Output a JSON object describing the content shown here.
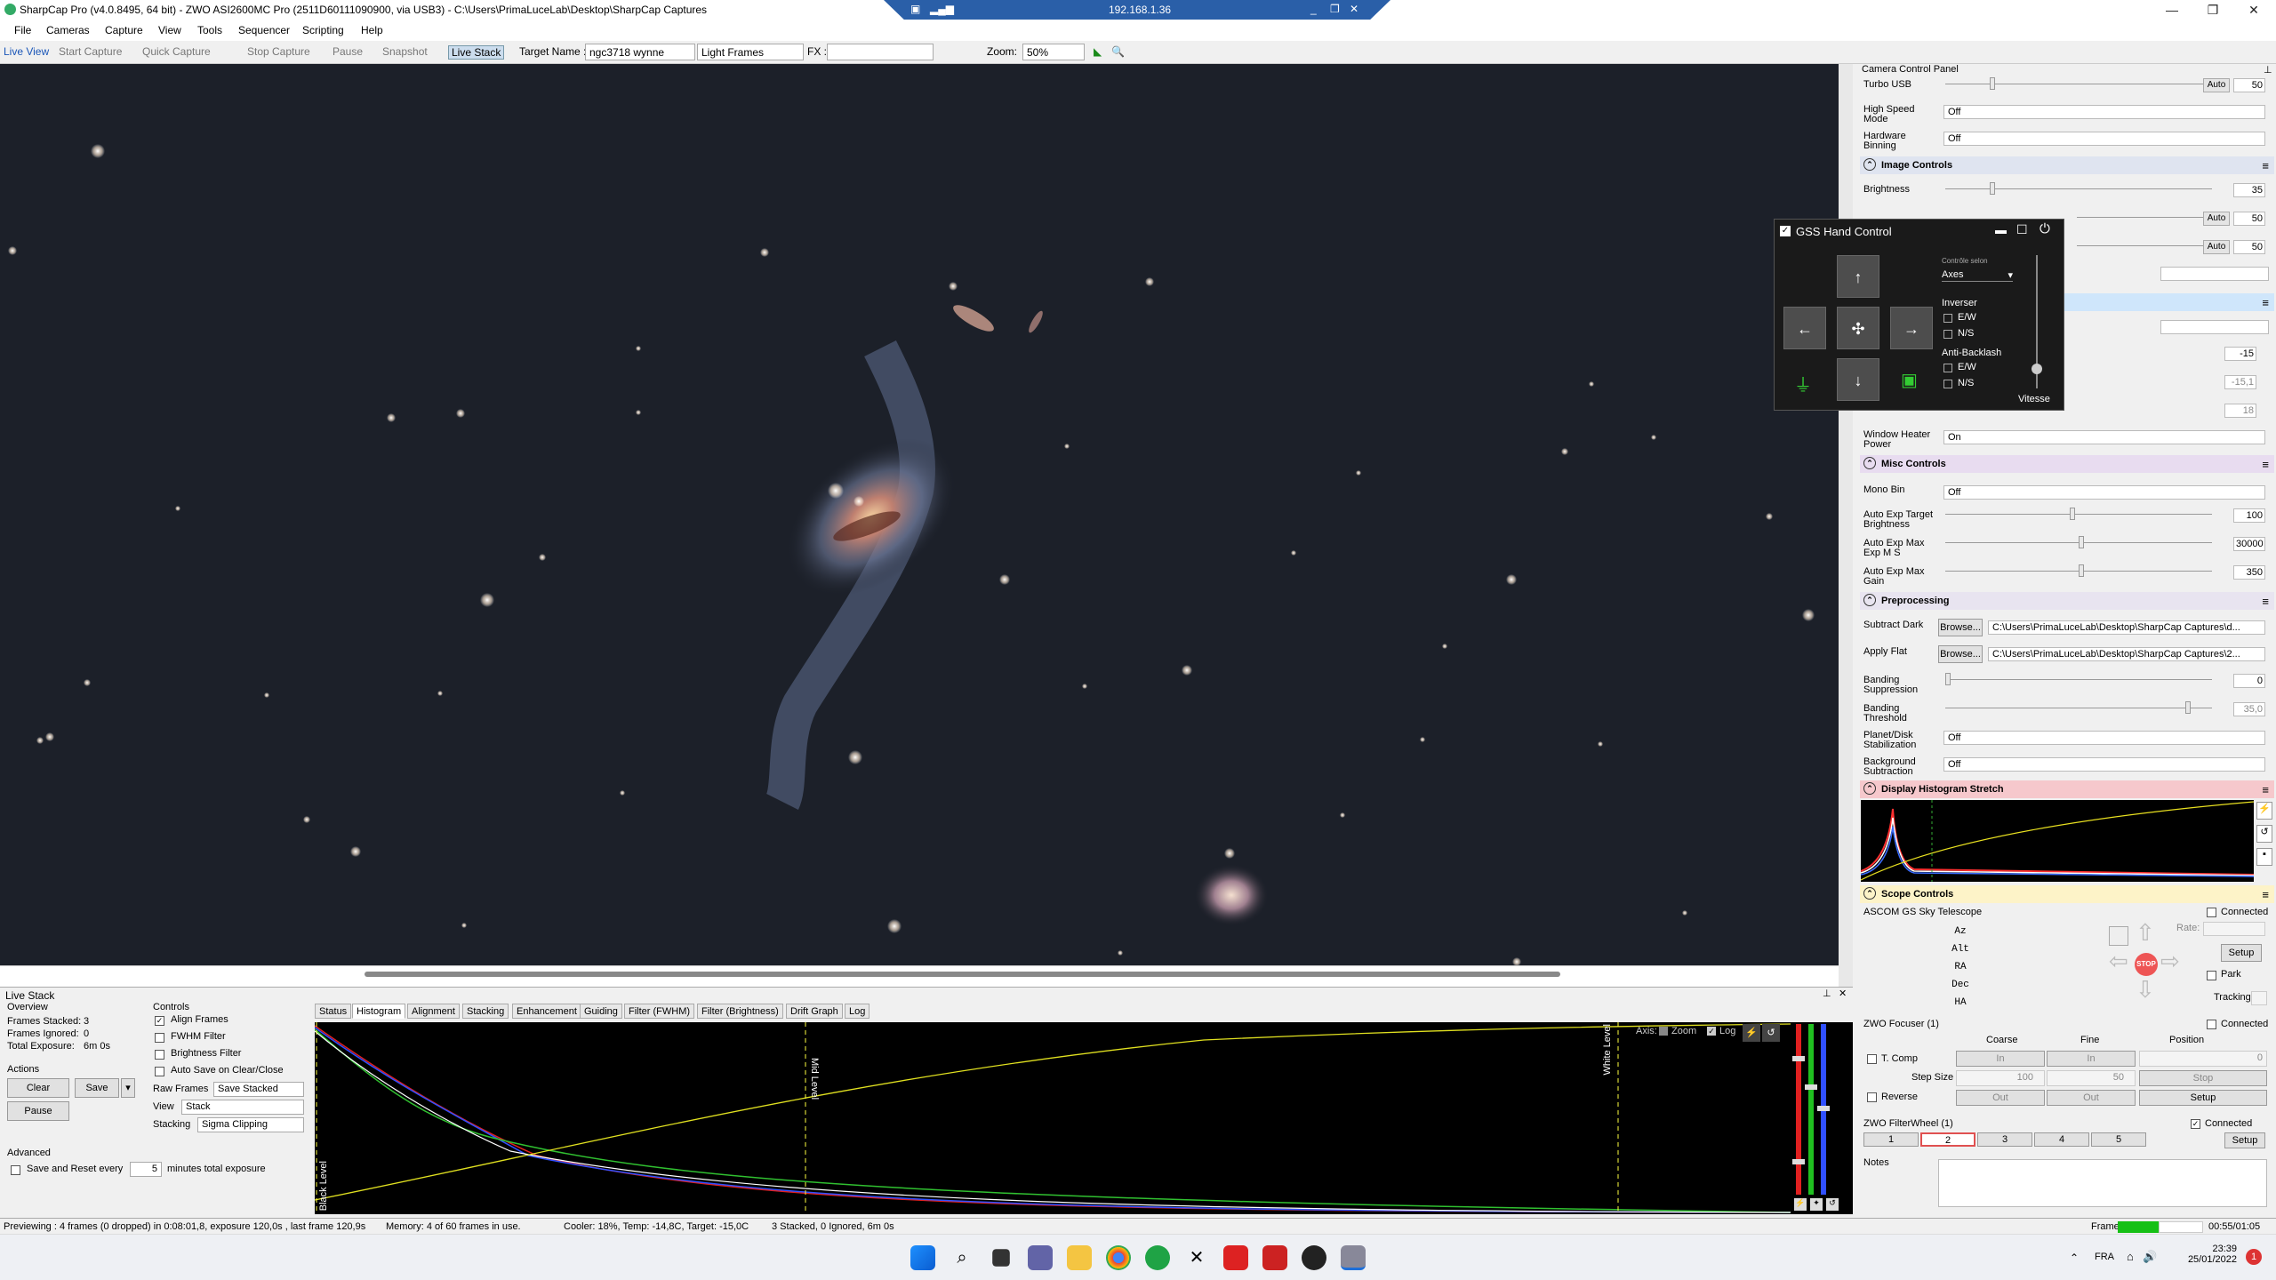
{
  "app": {
    "title": "SharpCap Pro (v4.0.8495, 64 bit) - ZWO ASI2600MC Pro (2511D60111090900, via USB3) - C:\\Users\\PrimaLuceLab\\Desktop\\SharpCap Captures",
    "remote_ip": "192.168.1.36"
  },
  "menu": [
    "File",
    "Cameras",
    "Capture",
    "View",
    "Tools",
    "Sequencer",
    "Scripting",
    "Help"
  ],
  "toolbar": {
    "live_view": "Live View",
    "start_capture": "Start Capture",
    "quick_capture": "Quick Capture",
    "stop_capture": "Stop Capture",
    "pause": "Pause",
    "snapshot": "Snapshot",
    "live_stack": "Live Stack",
    "target_label": "Target Name :",
    "target_value": "ngc3718 wynne",
    "frame_type": "Light Frames",
    "fx_label": "FX :",
    "zoom_label": "Zoom:",
    "zoom_value": "50%"
  },
  "ccp": {
    "title": "Camera Control Panel",
    "turbo_usb": {
      "label": "Turbo USB",
      "auto": "Auto",
      "value": "50"
    },
    "high_speed": {
      "label": "High Speed Mode",
      "value": "Off"
    },
    "hw_binning": {
      "label": "Hardware Binning",
      "value": "Off"
    },
    "image_controls": "Image Controls",
    "brightness": {
      "label": "Brightness",
      "value": "35"
    },
    "row_a_auto": "Auto",
    "row_a_val": "50",
    "row_b_auto": "Auto",
    "row_b_val": "50",
    "temp_vals": [
      "-15",
      "-15,1",
      "18"
    ],
    "window_heater": {
      "label": "Window Heater Power",
      "value": "On"
    },
    "misc_controls": "Misc Controls",
    "mono_bin": {
      "label": "Mono Bin",
      "value": "Off"
    },
    "auto_exp_target": {
      "label": "Auto Exp Target Brightness",
      "value": "100"
    },
    "auto_exp_max_ms": {
      "label": "Auto Exp Max Exp M S",
      "value": "30000"
    },
    "auto_exp_max_gain": {
      "label": "Auto Exp Max Gain",
      "value": "350"
    },
    "preprocessing": "Preprocessing",
    "subtract_dark": {
      "label": "Subtract Dark",
      "button": "Browse...",
      "value": "C:\\Users\\PrimaLuceLab\\Desktop\\SharpCap Captures\\d..."
    },
    "apply_flat": {
      "label": "Apply Flat",
      "button": "Browse...",
      "value": "C:\\Users\\PrimaLuceLab\\Desktop\\SharpCap Captures\\2..."
    },
    "banding_supp": {
      "label": "Banding Suppression",
      "value": "0"
    },
    "banding_thresh": {
      "label": "Banding Threshold",
      "value": "35,0"
    },
    "planet_disk": {
      "label": "Planet/Disk Stabilization",
      "value": "Off"
    },
    "bg_sub": {
      "label": "Background Subtraction",
      "value": "Off"
    },
    "display_histogram": "Display Histogram Stretch",
    "scope_controls": "Scope Controls",
    "scope_name": "ASCOM GS Sky Telescope",
    "connected": "Connected",
    "coords": [
      "Az",
      "Alt",
      "RA",
      "Dec",
      "HA"
    ],
    "rate": "Rate:",
    "setup": "Setup",
    "park": "Park",
    "tracking": "Tracking",
    "stop": "STOP",
    "focuser": "ZWO Focuser (1)",
    "coarse": "Coarse",
    "fine": "Fine",
    "position": "Position",
    "tcomp": "T. Comp",
    "step_size": "Step Size",
    "step_coarse": "100",
    "step_fine": "50",
    "pos_val": "0",
    "in": "In",
    "out": "Out",
    "stop_btn": "Stop",
    "reverse": "Reverse",
    "filterwheel": "ZWO FilterWheel (1)",
    "filters": [
      "1",
      "2",
      "3",
      "4",
      "5"
    ],
    "notes": "Notes",
    "frame_label": "Frame:",
    "time": "00:55/01:05"
  },
  "gss": {
    "title": "GSS Hand Control",
    "controller": "Contrôle selon",
    "axes": "Axes",
    "inverser": "Inverser",
    "ew": "E/W",
    "ns": "N/S",
    "antibacklash": "Anti-Backlash",
    "vitesse": "Vitesse"
  },
  "livestack": {
    "title": "Live Stack",
    "overview": "Overview",
    "frames_stacked_lbl": "Frames Stacked:",
    "frames_stacked": "3",
    "frames_ignored_lbl": "Frames Ignored:",
    "frames_ignored": "0",
    "total_exp_lbl": "Total Exposure:",
    "total_exp": "6m 0s",
    "actions": "Actions",
    "clear": "Clear",
    "save": "Save",
    "pause": "Pause",
    "advanced": "Advanced",
    "save_reset": "Save and Reset every",
    "save_reset_val": "5",
    "minutes_total": "minutes total exposure",
    "controls": "Controls",
    "align_frames": "Align Frames",
    "fwhm_filter": "FWHM Filter",
    "brightness_filter": "Brightness Filter",
    "auto_save": "Auto Save on Clear/Close",
    "raw_frames_lbl": "Raw Frames",
    "raw_frames": "Save Stacked",
    "view_lbl": "View",
    "view": "Stack",
    "stacking_lbl": "Stacking",
    "stacking": "Sigma Clipping",
    "tabs": [
      "Status",
      "Histogram",
      "Alignment",
      "Stacking",
      "Enhancement",
      "Guiding",
      "Filter (FWHM)",
      "Filter (Brightness)",
      "Drift Graph",
      "Log"
    ],
    "axis_lbl": "Axis:",
    "zoom": "Zoom",
    "log": "Log",
    "black_level": "Black Level",
    "mid_level": "Mid Level",
    "white_level": "White Level"
  },
  "status": {
    "preview": "Previewing : 4 frames (0 dropped) in 0:08:01,8, exposure 120,0s , last frame 120,9s",
    "memory": "Memory: 4 of 60 frames in use.",
    "cooler": "Cooler: 18%, Temp: -14,8C, Target: -15,0C",
    "stacked": "3 Stacked, 0 Ignored, 6m 0s"
  },
  "taskbar": {
    "lang": "FRA",
    "time": "23:39",
    "date": "25/01/2022"
  }
}
